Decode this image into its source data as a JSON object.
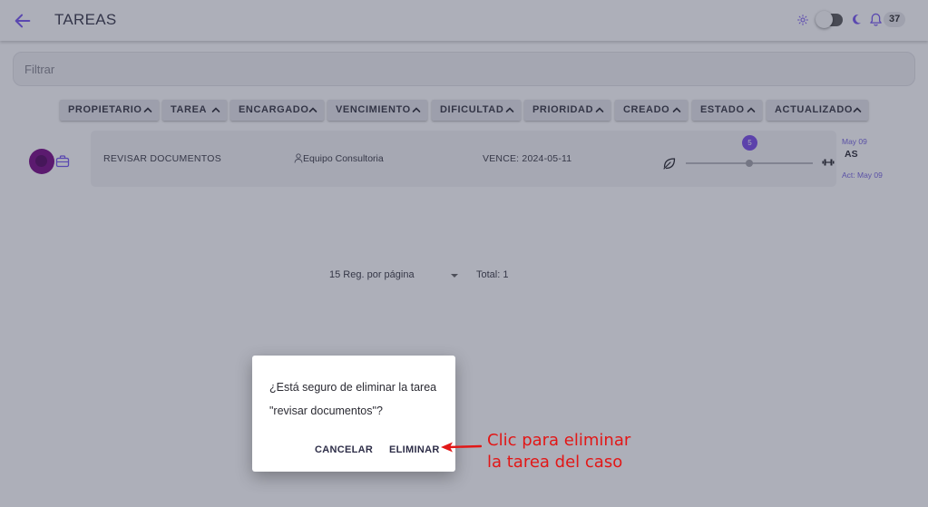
{
  "header": {
    "title": "TAREAS",
    "notification_count": "37"
  },
  "filter": {
    "placeholder": "Filtrar"
  },
  "sort_columns": [
    "PROPIETARIO",
    "TAREA",
    "ENCARGADO",
    "VENCIMIENTO",
    "DIFICULTAD",
    "PRIORIDAD",
    "CREADO",
    "ESTADO",
    "ACTUALIZADO"
  ],
  "task": {
    "name": "REVISAR DOCUMENTOS",
    "assignee": "Equipo Consultoria",
    "due": "VENCE: 2024-05-11",
    "difficulty_value": "5",
    "difficulty_fraction": 0.5,
    "created": "May 09",
    "initials": "AS",
    "updated": "Act: May 09"
  },
  "pagination": {
    "per_page": "15 Reg. por página",
    "total": "Total: 1"
  },
  "dialog": {
    "message": "¿Está seguro de eliminar la tarea \"revisar documentos\"?",
    "cancel_label": "CANCELAR",
    "delete_label": "ELIMINAR"
  },
  "annotation": {
    "line1": "Clic para eliminar",
    "line2": "la tarea del caso"
  },
  "colors": {
    "accent": "#7d4fe8",
    "avatar": "#7b0f88",
    "annotation": "#e21717"
  }
}
